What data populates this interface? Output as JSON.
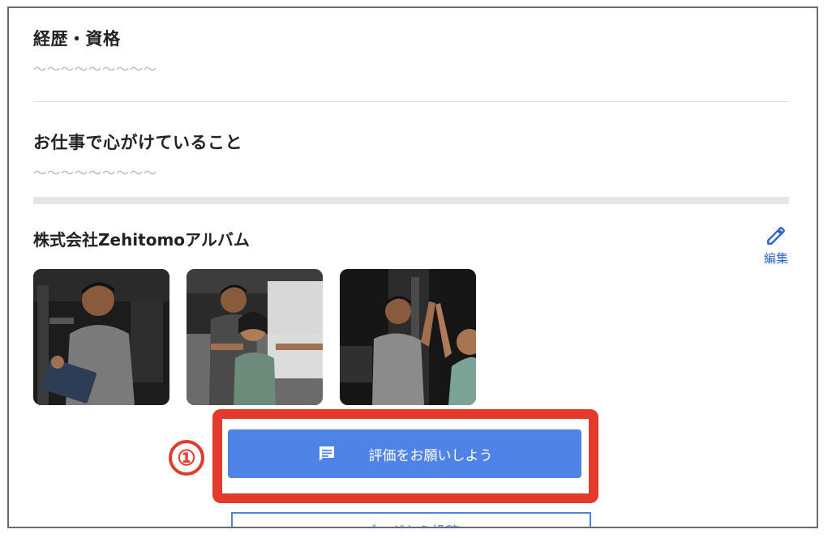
{
  "profile": {
    "career": {
      "title": "経歴・資格",
      "value": "〜〜〜〜〜〜〜〜〜"
    },
    "mindset": {
      "title": "お仕事で心がけていること",
      "value": "〜〜〜〜〜〜〜〜〜"
    }
  },
  "album": {
    "title": "株式会社Zehitomoアルバム",
    "edit_label": "編集",
    "edit_icon": "pencil-icon",
    "photos": [
      "photo-1",
      "photo-2",
      "photo-3"
    ]
  },
  "actions": {
    "review_label": "評価をお願いしよう",
    "review_icon": "message-icon",
    "blog_label": "ブログから投稿"
  },
  "annotation": {
    "step": "①",
    "color": "#e33a2c"
  },
  "colors": {
    "accent": "#4f83e6",
    "link": "#2b66c8"
  }
}
